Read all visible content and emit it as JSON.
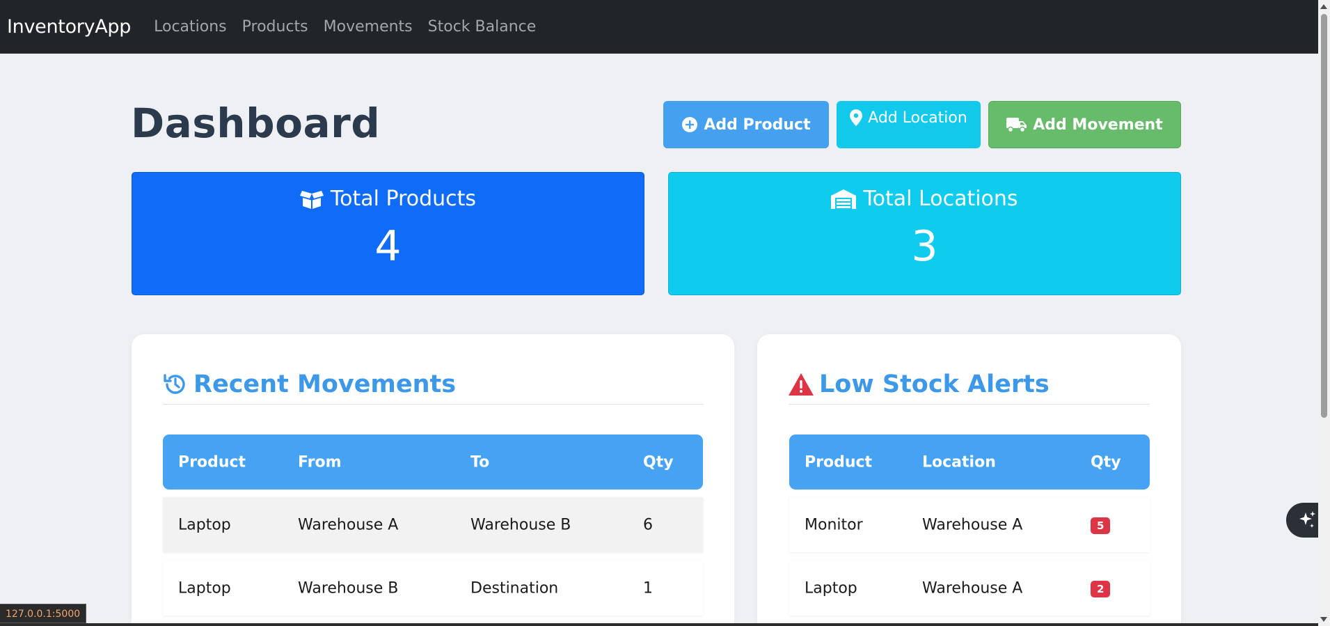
{
  "navbar": {
    "brand": "InventoryApp",
    "links": [
      "Locations",
      "Products",
      "Movements",
      "Stock Balance"
    ]
  },
  "header": {
    "title": "Dashboard",
    "buttons": {
      "add_product": "Add Product",
      "add_location": "Add Location",
      "add_movement": "Add Movement"
    }
  },
  "stats": {
    "products": {
      "label": "Total Products",
      "value": "4",
      "icon": "box-open-icon",
      "color": "#0f6cf9"
    },
    "locations": {
      "label": "Total Locations",
      "value": "3",
      "icon": "warehouse-icon",
      "color": "#0fcbee"
    }
  },
  "movements": {
    "title": "Recent Movements",
    "icon": "history-icon",
    "columns": [
      "Product",
      "From",
      "To",
      "Qty"
    ],
    "rows": [
      [
        "Laptop",
        "Warehouse A",
        "Warehouse B",
        "6"
      ],
      [
        "Laptop",
        "Warehouse B",
        "Destination",
        "1"
      ]
    ]
  },
  "alerts": {
    "title": "Low Stock Alerts",
    "icon": "warning-triangle-icon",
    "columns": [
      "Product",
      "Location",
      "Qty"
    ],
    "rows": [
      [
        "Monitor",
        "Warehouse A",
        "5"
      ],
      [
        "Laptop",
        "Warehouse A",
        "2"
      ]
    ]
  },
  "status_bar": {
    "url": "127.0.0.1:5000"
  },
  "colors": {
    "navbar": "#212529",
    "accent_blue": "#46a0f0",
    "accent_cyan": "#12c9ec",
    "accent_green": "#67bc6b",
    "badge_red": "#dc3545"
  }
}
